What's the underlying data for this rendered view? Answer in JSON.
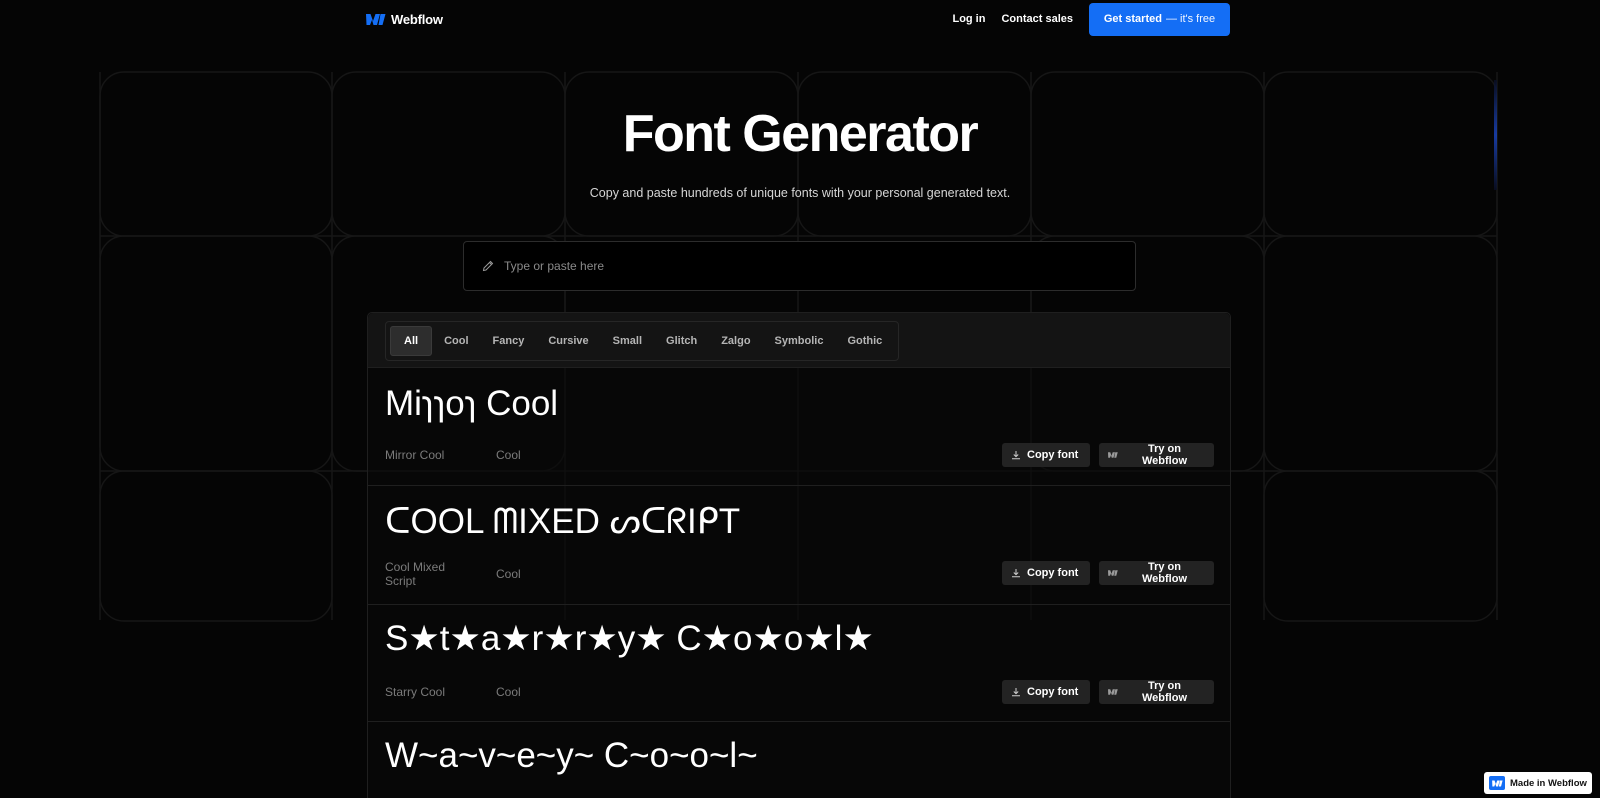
{
  "nav": {
    "brand": "Webflow",
    "login": "Log in",
    "contact": "Contact sales",
    "cta_main": "Get started",
    "cta_free": "— it's free"
  },
  "hero": {
    "title": "Font Generator",
    "subtitle": "Copy and paste hundreds of unique fonts with your personal generated text."
  },
  "search": {
    "placeholder": "Type or paste here",
    "value": ""
  },
  "tabs": [
    "All",
    "Cool",
    "Fancy",
    "Cursive",
    "Small",
    "Glitch",
    "Zalgo",
    "Symbolic",
    "Gothic"
  ],
  "active_tab": "All",
  "fonts": [
    {
      "preview": "Miɿɿoɿ Cool",
      "name": "Mirror Cool",
      "category": "Cool"
    },
    {
      "preview": "ᑕOOL ᗰIXED ᔕᑕᖇIᑭT",
      "name": "Cool Mixed Script",
      "category": "Cool"
    },
    {
      "preview": "S★t★a★r★r★y★ C★o★o★l★",
      "name": "Starry Cool",
      "category": "Cool"
    },
    {
      "preview": "W~a~v~e~y~ C~o~o~l~",
      "name": "",
      "category": ""
    }
  ],
  "buttons": {
    "copy": "Copy font",
    "try": "Try on Webflow"
  },
  "badge": "Made in Webflow",
  "colors": {
    "accent": "#146ef5",
    "background": "#050505",
    "muted_text": "#7b7b7b"
  },
  "icons": {
    "brand": "webflow-logo-icon",
    "input": "pencil-icon",
    "copy": "download-icon",
    "try": "webflow-logo-icon"
  }
}
